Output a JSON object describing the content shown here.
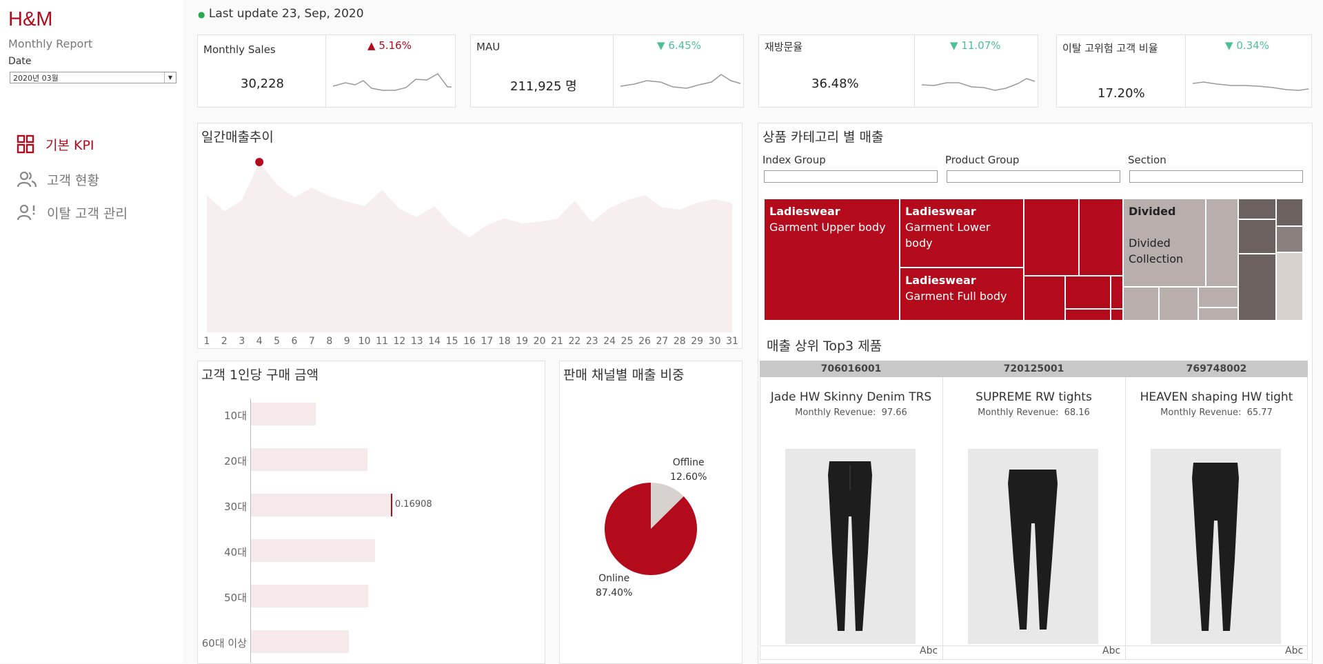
{
  "brand": "H&M",
  "subtitle": "Monthly Report",
  "date_label": "Date",
  "date_value": "2020년 03월",
  "last_update": "Last update 23, Sep, 2020",
  "nav": [
    {
      "label": "기본 KPI",
      "icon": "dashboard-icon",
      "active": true
    },
    {
      "label": "고객 현황",
      "icon": "users-icon",
      "active": false
    },
    {
      "label": "이탈 고객 관리",
      "icon": "user-alert-icon",
      "active": false
    }
  ],
  "kpis": [
    {
      "name": "Monthly Sales",
      "value": "30,228",
      "change": "5.16%",
      "direction": "up",
      "color": "#b30b1c"
    },
    {
      "name": "MAU",
      "value": "211,925 명",
      "change": "6.45%",
      "direction": "down",
      "color": "#4cbf9a"
    },
    {
      "name": "재방문율",
      "value": "36.48%",
      "change": "11.07%",
      "direction": "down",
      "color": "#4cbf9a"
    },
    {
      "name": "이탈 고위험 고객 비율",
      "value": "17.20%",
      "change": "0.34%",
      "direction": "down",
      "color": "#4cbf9a"
    }
  ],
  "daily": {
    "title": "일간매출추이",
    "days": [
      "1",
      "2",
      "3",
      "4",
      "5",
      "6",
      "7",
      "8",
      "9",
      "10",
      "11",
      "12",
      "13",
      "14",
      "15",
      "16",
      "17",
      "18",
      "19",
      "20",
      "21",
      "22",
      "23",
      "24",
      "25",
      "26",
      "27",
      "28",
      "29",
      "30",
      "31"
    ],
    "values": [
      1185,
      1045,
      1140,
      1470,
      1275,
      1165,
      1250,
      1175,
      1130,
      1090,
      1230,
      1065,
      995,
      1090,
      925,
      820,
      925,
      985,
      940,
      955,
      980,
      1135,
      950,
      1075,
      1140,
      1185,
      1080,
      1060,
      1120,
      1150,
      1115
    ],
    "highlight_day": "4",
    "ylim": [
      0,
      1500
    ]
  },
  "age": {
    "title": "고객 1인당 구매 금액",
    "categories": [
      "10대",
      "20대",
      "30대",
      "40대",
      "50대",
      "60대 이상"
    ],
    "values": [
      0.0787,
      0.1408,
      0.16908,
      0.1496,
      0.1418,
      0.1182
    ],
    "label": "0.16908",
    "xmax": 0.2
  },
  "channel": {
    "title": "판매 채널별 매출 비중",
    "slices": [
      {
        "name": "Offline",
        "pct": "12.60%",
        "value": 12.6,
        "color": "#d8d2ce"
      },
      {
        "name": "Online",
        "pct": "87.40%",
        "value": 87.4,
        "color": "#b30b1c"
      }
    ]
  },
  "category": {
    "title": "상품 카테고리 별 매출",
    "filters": [
      "Index Group",
      "Product Group",
      "Section"
    ],
    "treemap": [
      {
        "group": "Ladieswear",
        "product": "Garment Upper body"
      },
      {
        "group": "Ladieswear",
        "product": "Garment Lower body"
      },
      {
        "group": "Ladieswear",
        "product": "Garment Full body"
      },
      {
        "group": "Divided",
        "product": "Divided Collection"
      }
    ]
  },
  "top3": {
    "title": "매출 상위 Top3 제품",
    "revenue_label": "Monthly Revenue:",
    "products": [
      {
        "id": "706016001",
        "name": "Jade HW Skinny Denim TRS",
        "revenue": "97.66",
        "footer": "Abc"
      },
      {
        "id": "720125001",
        "name": "SUPREME RW tights",
        "revenue": "68.16",
        "footer": "Abc"
      },
      {
        "id": "769748002",
        "name": "HEAVEN shaping HW tight",
        "revenue": "65.77",
        "footer": "Abc"
      }
    ]
  },
  "colors": {
    "accent": "#b30b1c",
    "area": "#f7eef0",
    "gray": "#b8aeab",
    "dark": "#6b6260"
  }
}
